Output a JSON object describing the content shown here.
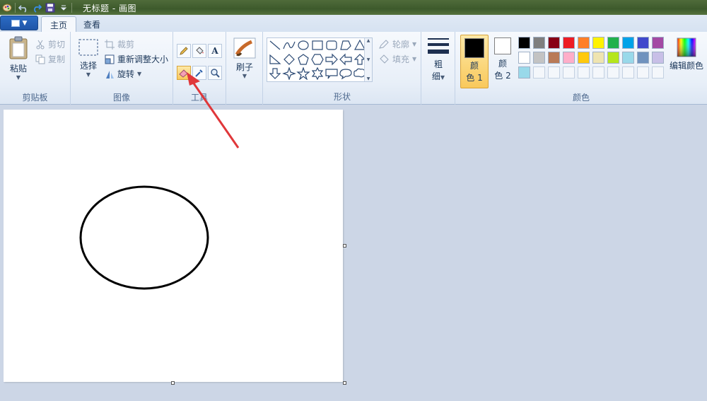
{
  "window": {
    "title": "无标题 - 画图"
  },
  "quick_access": {
    "icons": [
      "paint-app-icon",
      "undo-icon",
      "redo-icon",
      "save-icon",
      "customize-dropdown-icon"
    ]
  },
  "tabs": [
    {
      "label": "主页",
      "active": true
    },
    {
      "label": "查看",
      "active": false
    }
  ],
  "ribbon": {
    "clipboard": {
      "group_label": "剪贴板",
      "paste_label": "粘贴",
      "cut_label": "剪切",
      "copy_label": "复制"
    },
    "image": {
      "group_label": "图像",
      "select_label": "选择",
      "crop_label": "裁剪",
      "resize_label": "重新调整大小",
      "rotate_label": "旋转"
    },
    "tools": {
      "group_label": "工具",
      "items": [
        "pencil",
        "fill",
        "text",
        "eraser",
        "color-picker",
        "magnifier"
      ],
      "selected": "eraser",
      "text_glyph": "A"
    },
    "brushes": {
      "label": "刷子"
    },
    "shapes": {
      "group_label": "形状",
      "outline_label": "轮廓",
      "fill_label": "填充"
    },
    "size": {
      "label_line1": "粗",
      "label_line2": "细"
    },
    "colors": {
      "group_label": "颜色",
      "color1_line1": "颜",
      "color1_line2": "色 1",
      "color1_value": "#000000",
      "color2_line1": "颜",
      "color2_line2": "色 2",
      "color2_value": "#ffffff",
      "edit_label": "编辑颜色",
      "palette_row1": [
        "#000000",
        "#7f7f7f",
        "#880015",
        "#ed1c24",
        "#ff7f27",
        "#fff200",
        "#22b14c",
        "#00a2e8",
        "#3f48cc",
        "#a349a4"
      ],
      "palette_row2": [
        "#ffffff",
        "#c3c3c3",
        "#b97a57",
        "#ffaec9",
        "#ffc90e",
        "#efe4b0",
        "#b5e61d",
        "#99d9ea",
        "#7092be",
        "#c8bfe7"
      ],
      "palette_row3": [
        "#99d9ea",
        "",
        "",
        "",
        "",
        "",
        "",
        "",
        "",
        ""
      ]
    }
  },
  "canvas": {
    "background": "#ffffff",
    "drawing": "ellipse"
  },
  "annotation": {
    "color": "#e0373a"
  }
}
